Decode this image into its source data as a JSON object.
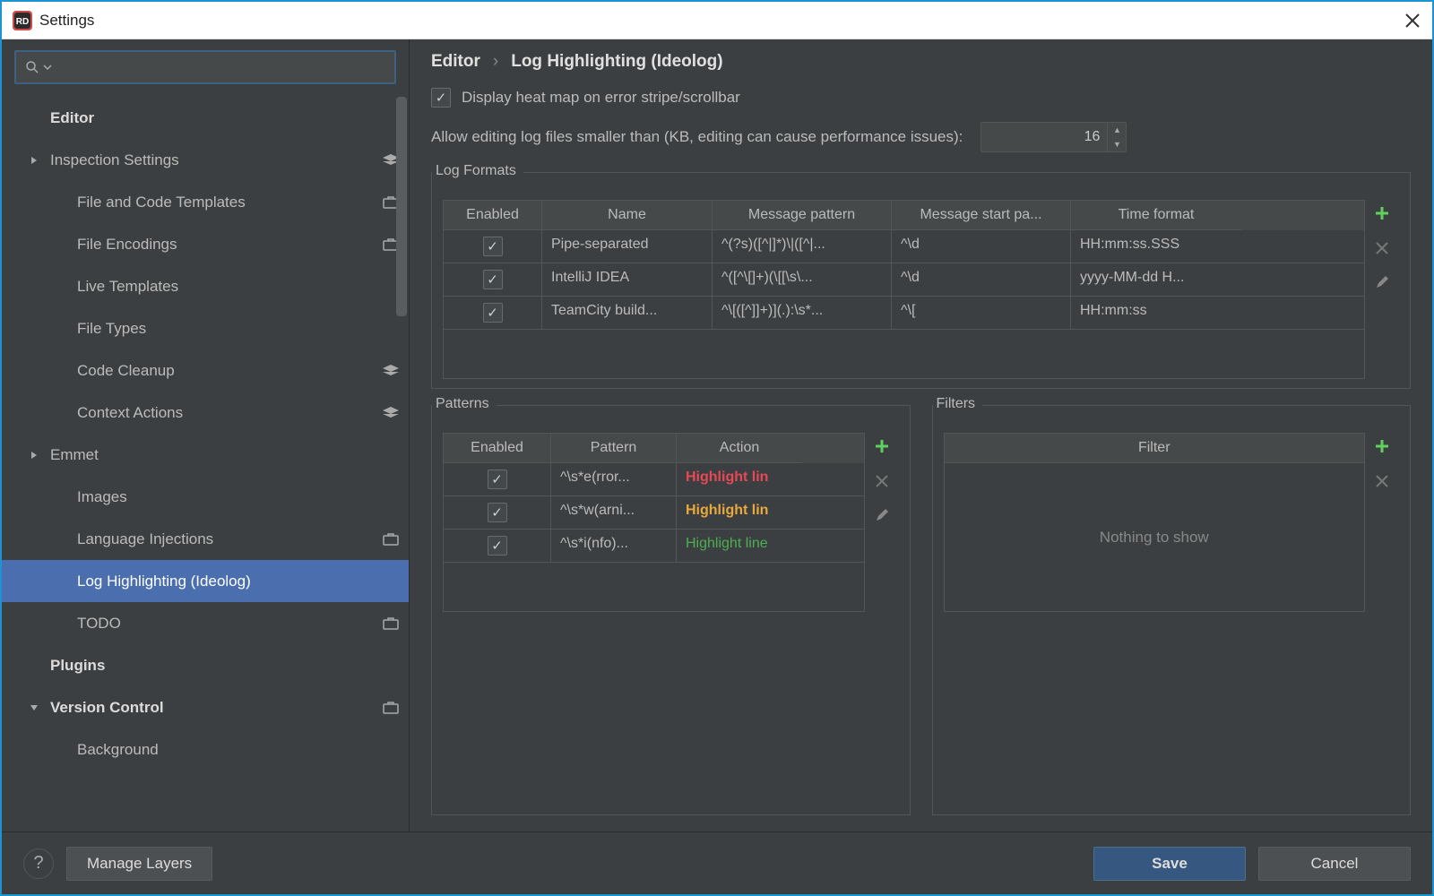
{
  "window": {
    "title": "Settings"
  },
  "breadcrumb": {
    "root": "Editor",
    "current": "Log Highlighting (Ideolog)"
  },
  "checkbox": {
    "heatmap": "Display heat map on error stripe/scrollbar"
  },
  "allow_label": "Allow editing log files smaller than (KB, editing can cause performance issues):",
  "allow_value": "16",
  "sidebar": {
    "items": [
      {
        "label": "Editor",
        "bold": true,
        "indent": 0,
        "arrow": false
      },
      {
        "label": "Inspection Settings",
        "indent": 0,
        "arrow": true,
        "layers": true
      },
      {
        "label": "File and Code Templates",
        "indent": 1,
        "briefcase": true
      },
      {
        "label": "File Encodings",
        "indent": 1,
        "briefcase": true
      },
      {
        "label": "Live Templates",
        "indent": 1
      },
      {
        "label": "File Types",
        "indent": 1
      },
      {
        "label": "Code Cleanup",
        "indent": 1,
        "layers": true
      },
      {
        "label": "Context Actions",
        "indent": 1,
        "layers": true
      },
      {
        "label": "Emmet",
        "indent": 0,
        "arrow": true
      },
      {
        "label": "Images",
        "indent": 1
      },
      {
        "label": "Language Injections",
        "indent": 1,
        "briefcase": true
      },
      {
        "label": "Log Highlighting (Ideolog)",
        "indent": 1,
        "selected": true
      },
      {
        "label": "TODO",
        "indent": 1,
        "briefcase": true
      },
      {
        "label": "Plugins",
        "bold": true,
        "indent": 0
      },
      {
        "label": "Version Control",
        "bold": true,
        "indent": 0,
        "arrow_down": true,
        "briefcase": true
      },
      {
        "label": "Background",
        "indent": 1
      }
    ]
  },
  "log_formats": {
    "legend": "Log Formats",
    "cols": [
      "Enabled",
      "Name",
      "Message pattern",
      "Message start pa...",
      "Time format"
    ],
    "rows": [
      {
        "enabled": true,
        "name": "Pipe-separated",
        "msg": "^(?s)([^|]*)\\|([^|...",
        "start": "^\\d",
        "time": "HH:mm:ss.SSS"
      },
      {
        "enabled": true,
        "name": "IntelliJ IDEA",
        "msg": "^([^\\[]+)(\\[[\\s\\...",
        "start": "^\\d",
        "time": "yyyy-MM-dd H..."
      },
      {
        "enabled": true,
        "name": "TeamCity build...",
        "msg": "^\\[([^]]+)](.):\\s*...",
        "start": "^\\[",
        "time": "HH:mm:ss"
      }
    ]
  },
  "patterns": {
    "legend": "Patterns",
    "cols": [
      "Enabled",
      "Pattern",
      "Action"
    ],
    "rows": [
      {
        "enabled": true,
        "pattern": "^\\s*e(rror...",
        "action": "Highlight lin",
        "cls": "hl-red"
      },
      {
        "enabled": true,
        "pattern": "^\\s*w(arni...",
        "action": "Highlight lin",
        "cls": "hl-yellow"
      },
      {
        "enabled": true,
        "pattern": "^\\s*i(nfo)...",
        "action": "Highlight line",
        "cls": "hl-green"
      }
    ]
  },
  "filters": {
    "legend": "Filters",
    "col": "Filter",
    "empty": "Nothing to show"
  },
  "footer": {
    "manage": "Manage Layers",
    "save": "Save",
    "cancel": "Cancel"
  }
}
